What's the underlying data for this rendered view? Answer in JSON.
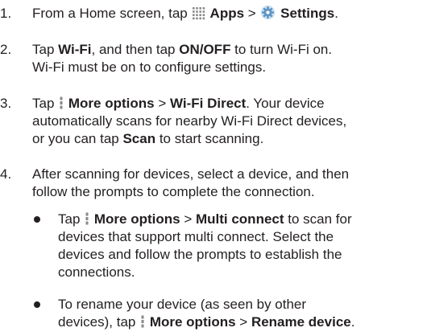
{
  "steps": [
    {
      "number": "1.",
      "lines": [
        [
          {
            "text": "From a Home screen, tap "
          },
          {
            "icon": "apps-grid-icon"
          },
          {
            "text": " Apps",
            "bold": true
          },
          {
            "text": " > "
          },
          {
            "icon": "settings-gear-icon"
          },
          {
            "text": " Settings",
            "bold": true
          },
          {
            "text": "."
          }
        ]
      ]
    },
    {
      "number": "2.",
      "lines": [
        [
          {
            "text": "Tap "
          },
          {
            "text": "Wi-Fi",
            "bold": true
          },
          {
            "text": ", and then tap "
          },
          {
            "text": "ON/OFF",
            "bold": true
          },
          {
            "text": " to turn Wi-Fi on."
          }
        ],
        [
          {
            "text": "Wi-Fi must be on to configure settings."
          }
        ]
      ]
    },
    {
      "number": "3.",
      "lines": [
        [
          {
            "text": "Tap "
          },
          {
            "icon": "more-options-icon"
          },
          {
            "text": " More options",
            "bold": true
          },
          {
            "text": " > "
          },
          {
            "text": "Wi-Fi Direct",
            "bold": true
          },
          {
            "text": ". Your device"
          }
        ],
        [
          {
            "text": "automatically scans for nearby Wi-Fi Direct devices,"
          }
        ],
        [
          {
            "text": "or you can tap "
          },
          {
            "text": "Scan",
            "bold": true
          },
          {
            "text": " to start scanning."
          }
        ]
      ]
    },
    {
      "number": "4.",
      "lines": [
        [
          {
            "text": "After scanning for devices, select a device, and then"
          }
        ],
        [
          {
            "text": "follow the prompts to complete the connection."
          }
        ]
      ]
    }
  ],
  "bullets": [
    {
      "lines": [
        [
          {
            "text": "Tap "
          },
          {
            "icon": "more-options-icon"
          },
          {
            "text": " More options",
            "bold": true
          },
          {
            "text": " > "
          },
          {
            "text": "Multi connect",
            "bold": true
          },
          {
            "text": " to scan for"
          }
        ],
        [
          {
            "text": "devices that support multi connect. Select the"
          }
        ],
        [
          {
            "text": "devices and follow the prompts to establish the"
          }
        ],
        [
          {
            "text": "connections."
          }
        ]
      ]
    },
    {
      "lines": [
        [
          {
            "text": "To rename your device (as seen by other"
          }
        ],
        [
          {
            "text": "devices), tap "
          },
          {
            "icon": "more-options-icon"
          },
          {
            "text": " More options",
            "bold": true
          },
          {
            "text": " > "
          },
          {
            "text": "Rename device",
            "bold": true
          },
          {
            "text": "."
          }
        ]
      ]
    }
  ]
}
